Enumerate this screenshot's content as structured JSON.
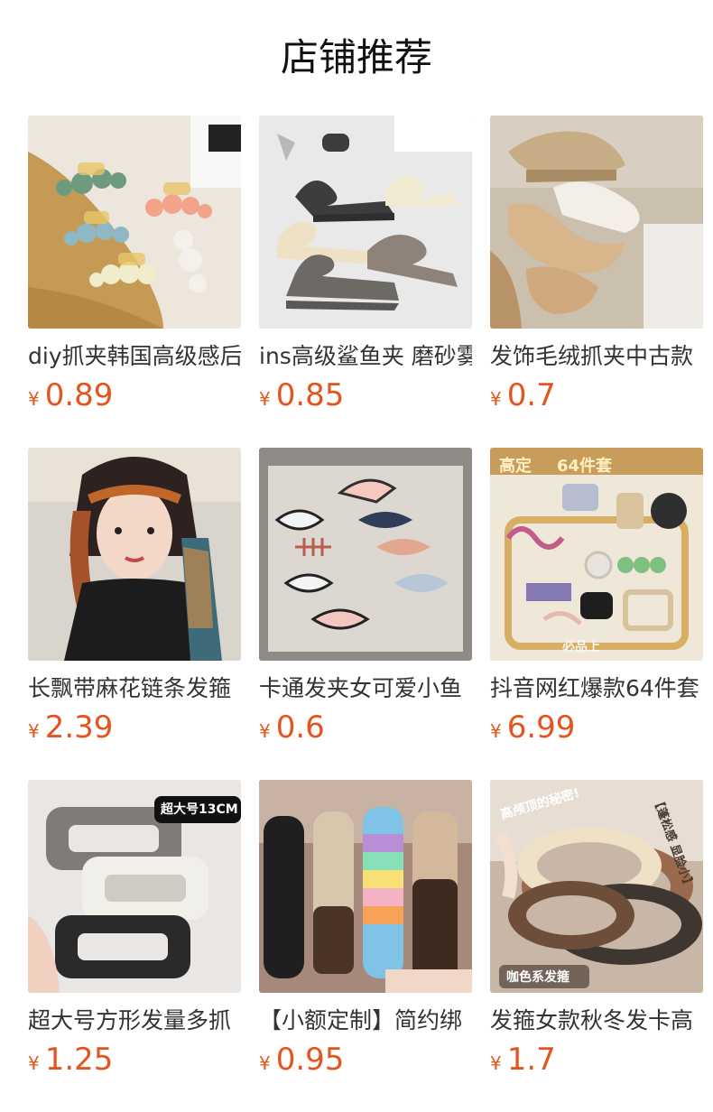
{
  "page": {
    "title": "店铺推荐"
  },
  "products": [
    {
      "title": "diy抓夹韩国高级感后",
      "currency": "¥",
      "price": "0.89"
    },
    {
      "title": "ins高级鲨鱼夹 磨砂雾",
      "currency": "¥",
      "price": "0.85"
    },
    {
      "title": "发饰毛绒抓夹中古款",
      "currency": "¥",
      "price": "0.7"
    },
    {
      "title": "长飘带麻花链条发箍",
      "currency": "¥",
      "price": "2.39"
    },
    {
      "title": "卡通发夹女可爱小鱼",
      "currency": "¥",
      "price": "0.6"
    },
    {
      "title": "抖音网红爆款64件套",
      "currency": "¥",
      "price": "6.99"
    },
    {
      "title": "超大号方形发量多抓",
      "currency": "¥",
      "price": "1.25"
    },
    {
      "title": "【小额定制】简约绑",
      "currency": "¥",
      "price": "0.95"
    },
    {
      "title": "发箍女款秋冬发卡高",
      "currency": "¥",
      "price": "1.7"
    }
  ],
  "image_overlays": {
    "p6_top_left": "高定",
    "p6_top_right": "64件套",
    "p6_bottom": "必品上",
    "p7_badge": "超大号13CM",
    "p9_left": "高颅顶的秘密!",
    "p9_right": "【蓬松感 显脸小】",
    "p9_bottom": "咖色系发箍"
  },
  "colors": {
    "accent_price": "#e4541f",
    "text": "#333333",
    "background": "#ffffff"
  }
}
